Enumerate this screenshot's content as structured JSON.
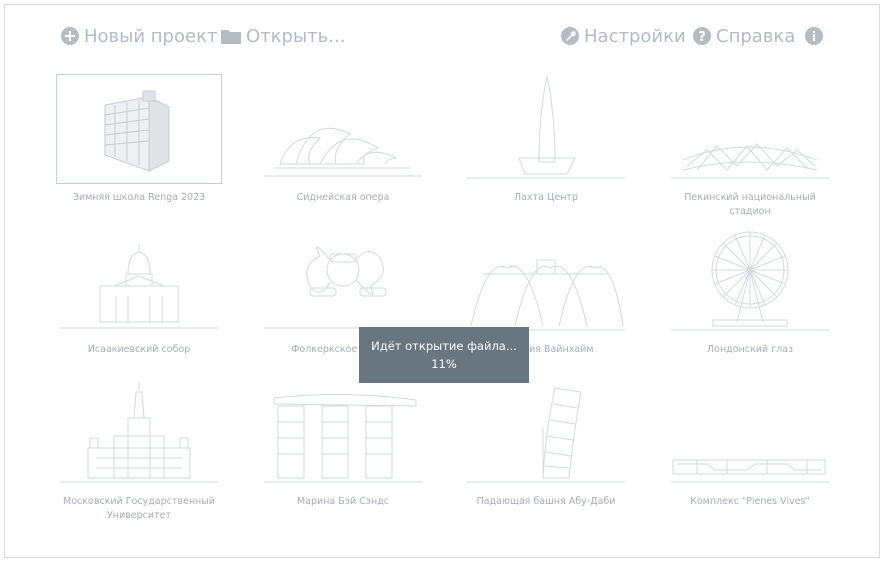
{
  "toolbar": {
    "new_project": "Новый проект",
    "open": "Открыть...",
    "settings": "Настройки",
    "help": "Справка"
  },
  "icons": {
    "new_project": "plus-circle-icon",
    "open": "folder-icon",
    "settings": "wrench-icon",
    "help": "question-circle-icon",
    "info": "info-circle-icon"
  },
  "projects": [
    {
      "title": "Зимняя школа Renga 2023",
      "selected": true
    },
    {
      "title": "Сиднейская опера"
    },
    {
      "title": "Лахта Центр"
    },
    {
      "title": "Пекинский национальный стадион"
    },
    {
      "title": "Исаакиевский собор"
    },
    {
      "title": "Фолкеркское колесо"
    },
    {
      "title": "Станция Вайнхайм"
    },
    {
      "title": "Лондонский глаз"
    },
    {
      "title": "Московский Государственный Университет"
    },
    {
      "title": "Марина Бэй Сэндс"
    },
    {
      "title": "Падающая башня Абу-Даби"
    },
    {
      "title": "Комплекс \"Pienes Vives\""
    }
  ],
  "loading": {
    "text": "Идёт открытие файла...",
    "percent": "11%",
    "progress": 0.11
  },
  "colors": {
    "toolbar_text": "#b4bbc3",
    "caption_text": "#a6adb4",
    "overlay_bg": "#687682",
    "overlay_text": "#ffffff",
    "line_art": "#d3d8dc"
  }
}
